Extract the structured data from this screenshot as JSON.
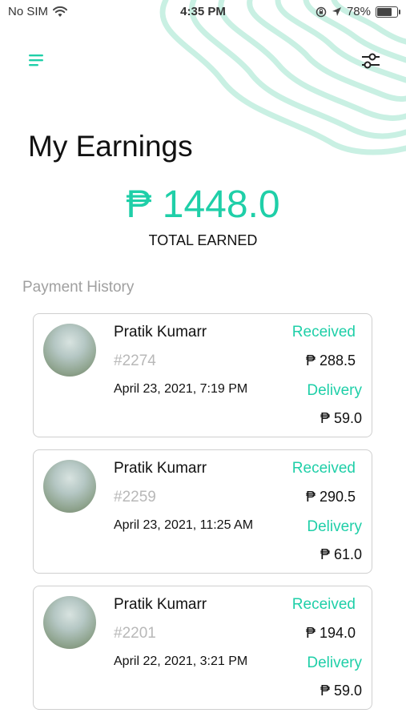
{
  "status_bar": {
    "carrier": "No SIM",
    "time": "4:35 PM",
    "battery_percent": "78%",
    "battery_level": 0.78
  },
  "header": {
    "menu_icon": "hamburger-menu-icon",
    "filter_icon": "sliders-filter-icon"
  },
  "page": {
    "title": "My Earnings",
    "total_amount": "₱ 1448.0",
    "total_label": "TOTAL EARNED",
    "section_title": "Payment History"
  },
  "payments": [
    {
      "name": "Pratik Kumarr",
      "order_id": "#2274",
      "datetime": "April 23, 2021, 7:19 PM",
      "received_label": "Received",
      "received_amount": "₱ 288.5",
      "delivery_label": "Delivery",
      "delivery_amount": "₱ 59.0"
    },
    {
      "name": "Pratik Kumarr",
      "order_id": "#2259",
      "datetime": "April 23, 2021, 11:25 AM",
      "received_label": "Received",
      "received_amount": "₱ 290.5",
      "delivery_label": "Delivery",
      "delivery_amount": "₱ 61.0"
    },
    {
      "name": "Pratik Kumarr",
      "order_id": "#2201",
      "datetime": "April 22, 2021, 3:21 PM",
      "received_label": "Received",
      "received_amount": "₱ 194.0",
      "delivery_label": "Delivery",
      "delivery_amount": "₱ 59.0"
    }
  ],
  "colors": {
    "accent": "#1fcfa8",
    "wave": "#c9f0e3",
    "muted": "#a0a0a0"
  }
}
